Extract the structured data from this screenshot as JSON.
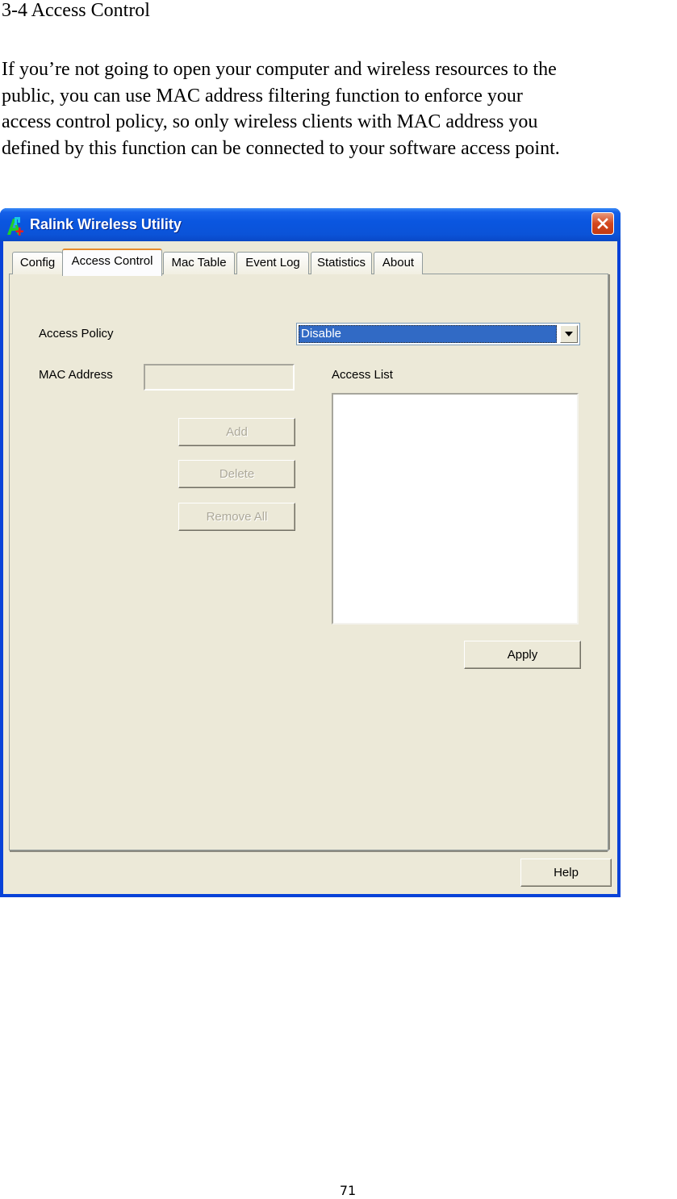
{
  "document": {
    "heading": "3-4 Access Control",
    "paragraph_lines": [
      "If you’re not going to open your computer and wireless resources to the",
      "public, you can use MAC address filtering function to enforce your",
      "access control policy, so only wireless clients with MAC address you",
      "defined by this function can be connected to your software access point."
    ],
    "page_number": "71"
  },
  "window": {
    "title": "Ralink Wireless Utility",
    "icon": "ralink-app-icon",
    "close_icon": "close-x-icon",
    "tabs": [
      {
        "label": "Config",
        "active": false
      },
      {
        "label": "Access Control",
        "active": true
      },
      {
        "label": "Mac Table",
        "active": false
      },
      {
        "label": "Event Log",
        "active": false
      },
      {
        "label": "Statistics",
        "active": false
      },
      {
        "label": "About",
        "active": false
      }
    ],
    "access_control": {
      "access_policy_label": "Access Policy",
      "access_policy_value": "Disable",
      "dropdown_icon": "chevron-down-icon",
      "mac_address_label": "MAC Address",
      "mac_address_value": "",
      "access_list_label": "Access List",
      "access_list_items": [],
      "buttons": {
        "add": "Add",
        "delete": "Delete",
        "remove_all": "Remove All",
        "apply": "Apply"
      }
    },
    "help_button": "Help"
  }
}
